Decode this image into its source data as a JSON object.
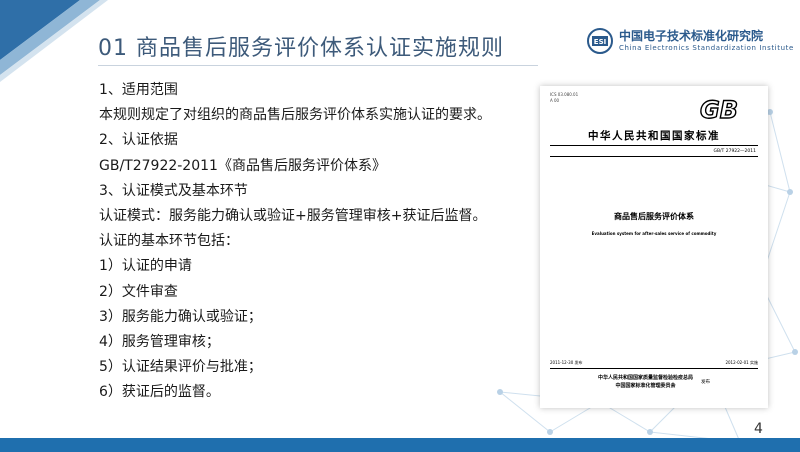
{
  "header": {
    "title": "01 商品售后服务评价体系认证实施规则",
    "logo_cn": "中国电子技术标准化研究院",
    "logo_en": "China Electronics Standardization Institute",
    "logo_mark_text": "ESI"
  },
  "content": {
    "lines": [
      "1、适用范围",
      "本规则规定了对组织的商品售后服务评价体系实施认证的要求。",
      "2、认证依据",
      "GB/T27922-2011《商品售后服务评价体系》",
      "3、认证模式及基本环节",
      "认证模式：服务能力确认或验证+服务管理审核+获证后监督。",
      "认证的基本环节包括：",
      "1）认证的申请",
      "2）文件审查",
      "3）服务能力确认或验证；",
      "4）服务管理审核；",
      "5）认证结果评价与批准；",
      "6）获证后的监督。"
    ]
  },
  "document": {
    "ics": "ICS 03.080.01",
    "ccs": "A 00",
    "gb_logo": "GB",
    "standard_name": "中华人民共和国国家标准",
    "standard_number": "GB/T 27922—2011",
    "title_cn": "商品售后服务评价体系",
    "title_en": "Evaluation system for after-sales service of commodity",
    "issue_date": "2011-12-30 发布",
    "effective_date": "2012-02-01 实施",
    "issuer_1": "中华人民共和国国家质量监督检验检疫总局",
    "issuer_2": "中国国家标准化管理委员会",
    "publish_label": "发布"
  },
  "footer": {
    "page_number": "4"
  },
  "colors": {
    "title": "#3d5a7a",
    "accent_blue": "#1f6fae",
    "logo_blue": "#2b5a8c"
  }
}
